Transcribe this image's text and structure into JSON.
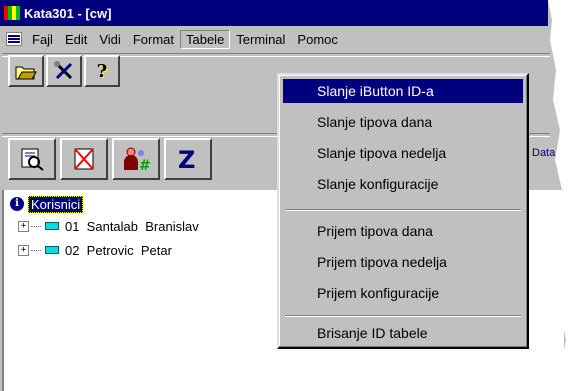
{
  "window": {
    "title": "Kata301 - [cw]"
  },
  "menubar": {
    "items": [
      {
        "label": "Fajl"
      },
      {
        "label": "Edit"
      },
      {
        "label": "Vidi"
      },
      {
        "label": "Format"
      },
      {
        "label": "Tabele"
      },
      {
        "label": "Terminal"
      },
      {
        "label": "Pomoc"
      }
    ]
  },
  "toolbar1": {
    "icons": [
      "open-folder-icon",
      "tools-icon",
      "help-icon"
    ]
  },
  "toolbar2": {
    "icons": [
      "preview-icon",
      "delete-icon",
      "users-icon",
      "zoom-icon"
    ],
    "data_fragment": "Data"
  },
  "tree": {
    "root": "Korisnici",
    "users": [
      {
        "label": "01  Santalab  Branislav"
      },
      {
        "label": "02  Petrovic  Petar"
      }
    ]
  },
  "dropdown": {
    "items": [
      {
        "label": "Slanje iButton ID-a",
        "highlighted": true
      },
      {
        "label": "Slanje tipova dana"
      },
      {
        "label": "Slanje tipova nedelja"
      },
      {
        "label": "Slanje konfiguracije"
      },
      {
        "label": "Prijem tipova dana"
      },
      {
        "label": "Prijem tipova nedelja"
      },
      {
        "label": "Prijem konfiguracije"
      },
      {
        "label": "Brisanje ID tabele"
      }
    ]
  },
  "colors": {
    "titlebar": "#00007f",
    "highlight": "#00007f",
    "face": "#c0c0c0"
  }
}
